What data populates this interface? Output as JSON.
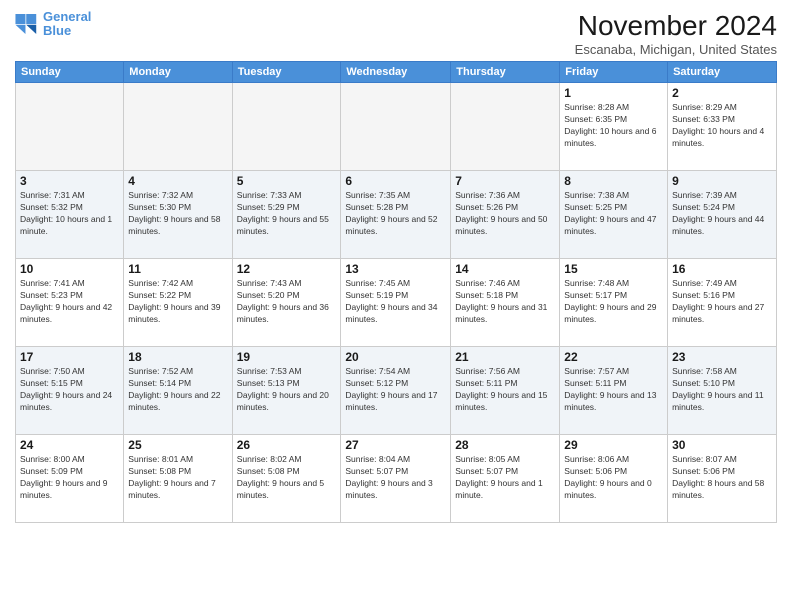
{
  "header": {
    "logo_line1": "General",
    "logo_line2": "Blue",
    "month_year": "November 2024",
    "location": "Escanaba, Michigan, United States"
  },
  "weekdays": [
    "Sunday",
    "Monday",
    "Tuesday",
    "Wednesday",
    "Thursday",
    "Friday",
    "Saturday"
  ],
  "weeks": [
    [
      {
        "day": "",
        "info": ""
      },
      {
        "day": "",
        "info": ""
      },
      {
        "day": "",
        "info": ""
      },
      {
        "day": "",
        "info": ""
      },
      {
        "day": "",
        "info": ""
      },
      {
        "day": "1",
        "info": "Sunrise: 8:28 AM\nSunset: 6:35 PM\nDaylight: 10 hours and 6 minutes."
      },
      {
        "day": "2",
        "info": "Sunrise: 8:29 AM\nSunset: 6:33 PM\nDaylight: 10 hours and 4 minutes."
      }
    ],
    [
      {
        "day": "3",
        "info": "Sunrise: 7:31 AM\nSunset: 5:32 PM\nDaylight: 10 hours and 1 minute."
      },
      {
        "day": "4",
        "info": "Sunrise: 7:32 AM\nSunset: 5:30 PM\nDaylight: 9 hours and 58 minutes."
      },
      {
        "day": "5",
        "info": "Sunrise: 7:33 AM\nSunset: 5:29 PM\nDaylight: 9 hours and 55 minutes."
      },
      {
        "day": "6",
        "info": "Sunrise: 7:35 AM\nSunset: 5:28 PM\nDaylight: 9 hours and 52 minutes."
      },
      {
        "day": "7",
        "info": "Sunrise: 7:36 AM\nSunset: 5:26 PM\nDaylight: 9 hours and 50 minutes."
      },
      {
        "day": "8",
        "info": "Sunrise: 7:38 AM\nSunset: 5:25 PM\nDaylight: 9 hours and 47 minutes."
      },
      {
        "day": "9",
        "info": "Sunrise: 7:39 AM\nSunset: 5:24 PM\nDaylight: 9 hours and 44 minutes."
      }
    ],
    [
      {
        "day": "10",
        "info": "Sunrise: 7:41 AM\nSunset: 5:23 PM\nDaylight: 9 hours and 42 minutes."
      },
      {
        "day": "11",
        "info": "Sunrise: 7:42 AM\nSunset: 5:22 PM\nDaylight: 9 hours and 39 minutes."
      },
      {
        "day": "12",
        "info": "Sunrise: 7:43 AM\nSunset: 5:20 PM\nDaylight: 9 hours and 36 minutes."
      },
      {
        "day": "13",
        "info": "Sunrise: 7:45 AM\nSunset: 5:19 PM\nDaylight: 9 hours and 34 minutes."
      },
      {
        "day": "14",
        "info": "Sunrise: 7:46 AM\nSunset: 5:18 PM\nDaylight: 9 hours and 31 minutes."
      },
      {
        "day": "15",
        "info": "Sunrise: 7:48 AM\nSunset: 5:17 PM\nDaylight: 9 hours and 29 minutes."
      },
      {
        "day": "16",
        "info": "Sunrise: 7:49 AM\nSunset: 5:16 PM\nDaylight: 9 hours and 27 minutes."
      }
    ],
    [
      {
        "day": "17",
        "info": "Sunrise: 7:50 AM\nSunset: 5:15 PM\nDaylight: 9 hours and 24 minutes."
      },
      {
        "day": "18",
        "info": "Sunrise: 7:52 AM\nSunset: 5:14 PM\nDaylight: 9 hours and 22 minutes."
      },
      {
        "day": "19",
        "info": "Sunrise: 7:53 AM\nSunset: 5:13 PM\nDaylight: 9 hours and 20 minutes."
      },
      {
        "day": "20",
        "info": "Sunrise: 7:54 AM\nSunset: 5:12 PM\nDaylight: 9 hours and 17 minutes."
      },
      {
        "day": "21",
        "info": "Sunrise: 7:56 AM\nSunset: 5:11 PM\nDaylight: 9 hours and 15 minutes."
      },
      {
        "day": "22",
        "info": "Sunrise: 7:57 AM\nSunset: 5:11 PM\nDaylight: 9 hours and 13 minutes."
      },
      {
        "day": "23",
        "info": "Sunrise: 7:58 AM\nSunset: 5:10 PM\nDaylight: 9 hours and 11 minutes."
      }
    ],
    [
      {
        "day": "24",
        "info": "Sunrise: 8:00 AM\nSunset: 5:09 PM\nDaylight: 9 hours and 9 minutes."
      },
      {
        "day": "25",
        "info": "Sunrise: 8:01 AM\nSunset: 5:08 PM\nDaylight: 9 hours and 7 minutes."
      },
      {
        "day": "26",
        "info": "Sunrise: 8:02 AM\nSunset: 5:08 PM\nDaylight: 9 hours and 5 minutes."
      },
      {
        "day": "27",
        "info": "Sunrise: 8:04 AM\nSunset: 5:07 PM\nDaylight: 9 hours and 3 minutes."
      },
      {
        "day": "28",
        "info": "Sunrise: 8:05 AM\nSunset: 5:07 PM\nDaylight: 9 hours and 1 minute."
      },
      {
        "day": "29",
        "info": "Sunrise: 8:06 AM\nSunset: 5:06 PM\nDaylight: 9 hours and 0 minutes."
      },
      {
        "day": "30",
        "info": "Sunrise: 8:07 AM\nSunset: 5:06 PM\nDaylight: 8 hours and 58 minutes."
      }
    ]
  ]
}
